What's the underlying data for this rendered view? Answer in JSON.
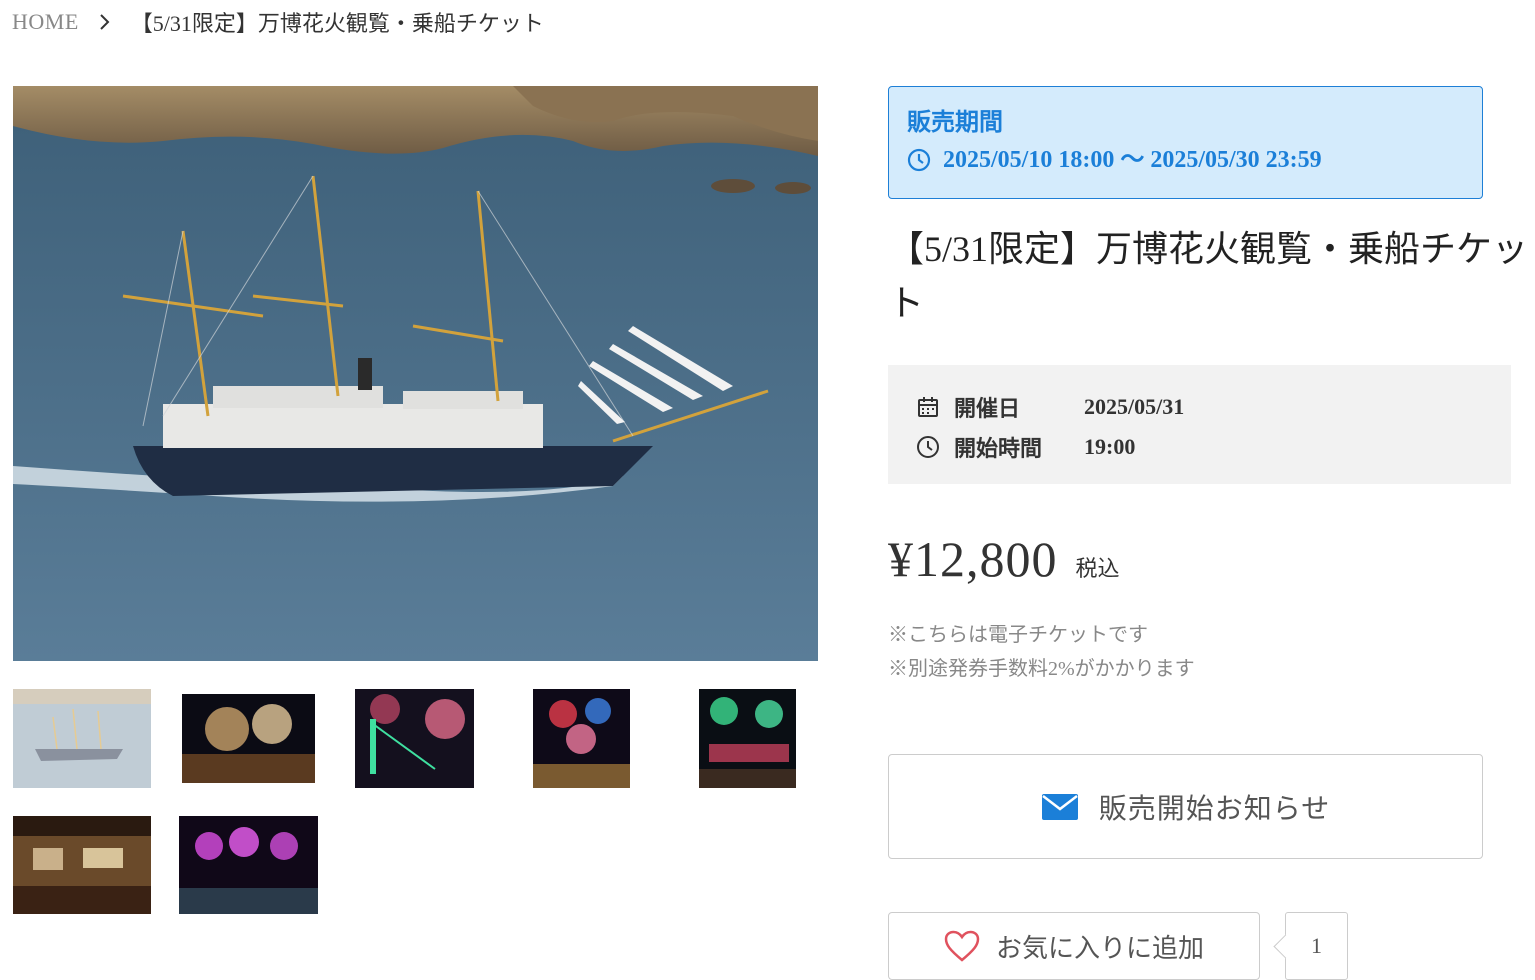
{
  "breadcrumb": {
    "home": "HOME",
    "current": "【5/31限定】万博花火観覧・乗船チケット"
  },
  "gallery": {
    "main_image": "main-ship-photo",
    "thumbnails": [
      "ship",
      "fireworks-gold",
      "fireworks-bridge",
      "fireworks-colorful",
      "fireworks-green-red",
      "ship-interior",
      "fireworks-pink"
    ]
  },
  "sale": {
    "label": "販売期間",
    "period": "2025/05/10 18:00 〜 2025/05/30 23:59",
    "icon": "clock-icon",
    "color": "#1b7fd8"
  },
  "product": {
    "title": "【5/31限定】万博花火観覧・乗船チケット"
  },
  "event": {
    "date_label": "開催日",
    "date_value": "2025/05/31",
    "time_label": "開始時間",
    "time_value": "19:00"
  },
  "price": {
    "amount": "¥12,800",
    "tax": "税込"
  },
  "notes": {
    "line1": "※こちらは電子チケットです",
    "line2": "※別途発券手数料2%がかかります"
  },
  "actions": {
    "notify_label": "販売開始お知らせ",
    "favorite_label": "お気に入りに追加",
    "favorite_count": "1"
  }
}
